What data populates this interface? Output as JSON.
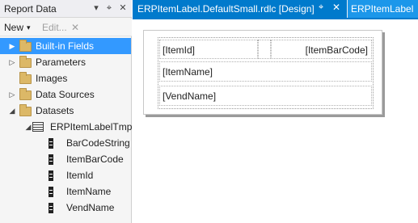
{
  "panel": {
    "title": "Report Data",
    "pin_icon": "▾",
    "pushpin_icon": "⌖",
    "close_icon": "✕",
    "toolbar": {
      "new_label": "New",
      "new_arrow": "▾",
      "edit_label": "Edit...",
      "delete_icon": "✕"
    }
  },
  "tree": [
    {
      "label": "Built-in Fields",
      "icon": "folder-icon",
      "expander": "▶",
      "selected": true
    },
    {
      "label": "Parameters",
      "icon": "folder-icon",
      "expander": "▷"
    },
    {
      "label": "Images",
      "icon": "folder-icon",
      "expander": ""
    },
    {
      "label": "Data Sources",
      "icon": "folder-icon",
      "expander": "▷"
    },
    {
      "label": "Datasets",
      "icon": "folder-icon",
      "expander": "◢"
    },
    {
      "label": "ERPItemLabelTmp",
      "icon": "dataset-icon",
      "expander": "◢"
    },
    {
      "label": "BarCodeString",
      "icon": "field-icon"
    },
    {
      "label": "ItemBarCode",
      "icon": "field-icon"
    },
    {
      "label": "ItemId",
      "icon": "field-icon"
    },
    {
      "label": "ItemName",
      "icon": "field-icon"
    },
    {
      "label": "VendName",
      "icon": "field-icon"
    }
  ],
  "tabs": {
    "active": {
      "label": "ERPItemLabel.DefaultSmall.rdlc [Design]",
      "pin_icon": "⌖",
      "close_icon": "✕"
    },
    "second": {
      "label": "ERPItemLabel"
    }
  },
  "report": {
    "cells": {
      "item_id": "[ItemId]",
      "item_barcode": "[ItemBarCode]",
      "item_name": "[ItemName]",
      "vend_name": "[VendName]"
    }
  },
  "colors": {
    "accent": "#007acc",
    "selection": "#3399ff",
    "panel_bg": "#f5f5f5"
  }
}
